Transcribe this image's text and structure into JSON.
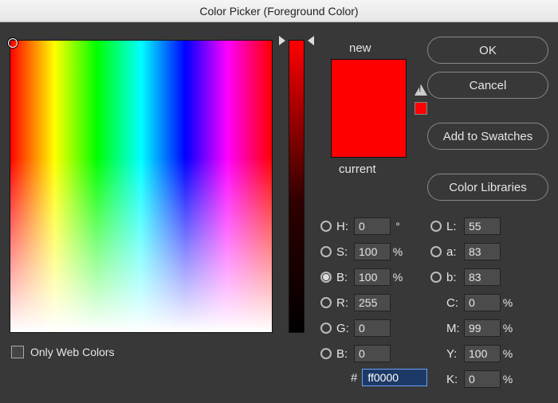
{
  "title": "Color Picker (Foreground Color)",
  "buttons": {
    "ok": "OK",
    "cancel": "Cancel",
    "add_swatches": "Add to Swatches",
    "color_libraries": "Color Libraries"
  },
  "preview": {
    "label_new": "new",
    "label_current": "current",
    "new_color": "#ff0000",
    "current_color": "#ff0000"
  },
  "only_web_colors": {
    "label": "Only Web Colors",
    "checked": false
  },
  "hsb": {
    "h": {
      "label": "H:",
      "value": "0",
      "suffix": "°",
      "selected": false
    },
    "s": {
      "label": "S:",
      "value": "100",
      "suffix": "%",
      "selected": false
    },
    "b": {
      "label": "B:",
      "value": "100",
      "suffix": "%",
      "selected": true
    }
  },
  "rgb": {
    "r": {
      "label": "R:",
      "value": "255",
      "selected": false
    },
    "g": {
      "label": "G:",
      "value": "0",
      "selected": false
    },
    "b": {
      "label": "B:",
      "value": "0",
      "selected": false
    }
  },
  "lab": {
    "l": {
      "label": "L:",
      "value": "55",
      "selected": false
    },
    "a": {
      "label": "a:",
      "value": "83",
      "selected": false
    },
    "b": {
      "label": "b:",
      "value": "83",
      "selected": false
    }
  },
  "cmyk": {
    "c": {
      "label": "C:",
      "value": "0",
      "suffix": "%"
    },
    "m": {
      "label": "M:",
      "value": "99",
      "suffix": "%"
    },
    "y": {
      "label": "Y:",
      "value": "100",
      "suffix": "%"
    },
    "k": {
      "label": "K:",
      "value": "0",
      "suffix": "%"
    }
  },
  "hex": {
    "label": "#",
    "value": "ff0000"
  }
}
